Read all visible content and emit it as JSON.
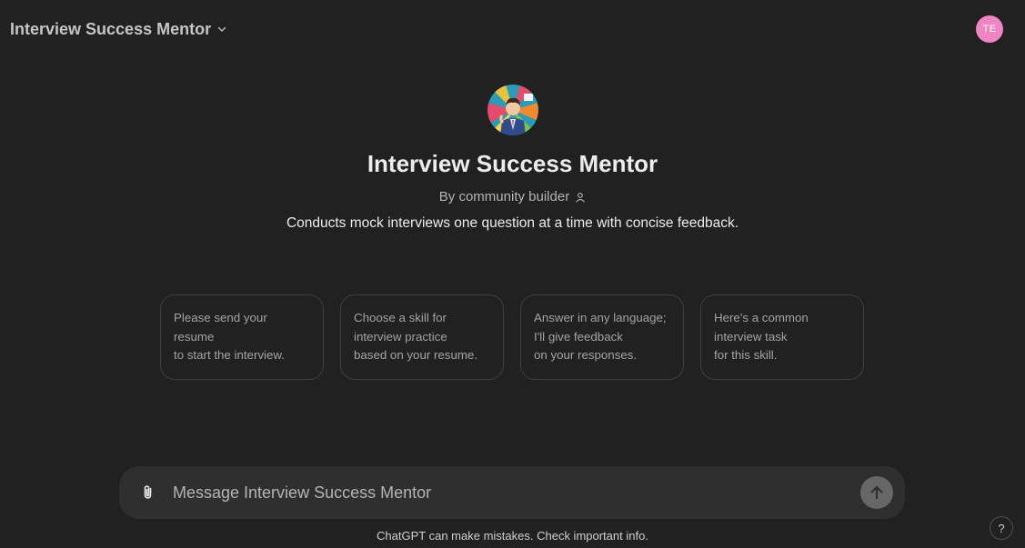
{
  "header": {
    "model_name": "Interview Success Mentor",
    "user_initials": "TE",
    "avatar_color": "#ef86c1"
  },
  "gpt": {
    "title": "Interview Success Mentor",
    "byline": "By community builder",
    "description": "Conducts mock interviews one question at a time with concise feedback."
  },
  "starters": [
    {
      "text": "Please send your resume\nto start the interview."
    },
    {
      "text": "Choose a skill for\ninterview practice\nbased on your resume."
    },
    {
      "text": "Answer in any language;\nI'll give feedback\non your responses."
    },
    {
      "text": "Here's a common\ninterview task\nfor this skill."
    }
  ],
  "composer": {
    "placeholder": "Message Interview Success Mentor",
    "attach_icon": "paperclip-icon",
    "send_icon": "arrow-up-icon"
  },
  "footer": {
    "note": "ChatGPT can make mistakes. Check important info.",
    "help_label": "?"
  }
}
